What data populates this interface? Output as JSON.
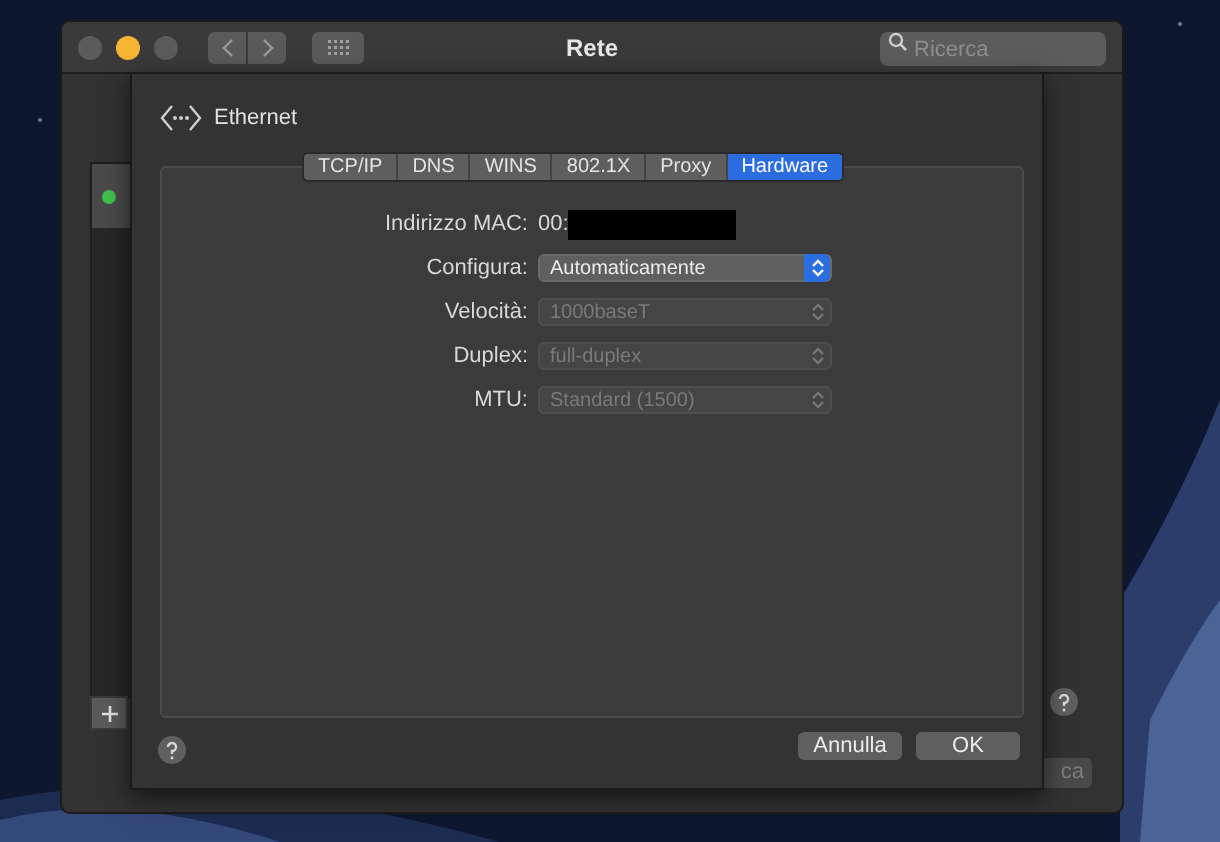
{
  "window": {
    "title": "Rete",
    "search": {
      "placeholder": "Ricerca"
    }
  },
  "sidebar": {
    "items": [
      {
        "color": "#3fc24a"
      }
    ]
  },
  "background_button": "ca",
  "sheet": {
    "title": "Ethernet",
    "tabs": [
      {
        "label": "TCP/IP",
        "selected": false
      },
      {
        "label": "DNS",
        "selected": false
      },
      {
        "label": "WINS",
        "selected": false
      },
      {
        "label": "802.1X",
        "selected": false
      },
      {
        "label": "Proxy",
        "selected": false
      },
      {
        "label": "Hardware",
        "selected": true
      }
    ],
    "fields": [
      {
        "kind": "text",
        "label": "Indirizzo MAC:",
        "value": "00:"
      },
      {
        "kind": "select",
        "label": "Configura:",
        "value": "Automaticamente",
        "disabled": false
      },
      {
        "kind": "select",
        "label": "Velocità:",
        "value": "1000baseT",
        "disabled": true
      },
      {
        "kind": "select",
        "label": "Duplex:",
        "value": "full-duplex",
        "disabled": true
      },
      {
        "kind": "select",
        "label": "MTU:",
        "value": "Standard  (1500)",
        "disabled": true
      }
    ],
    "buttons": [
      "Annulla",
      "OK"
    ]
  }
}
